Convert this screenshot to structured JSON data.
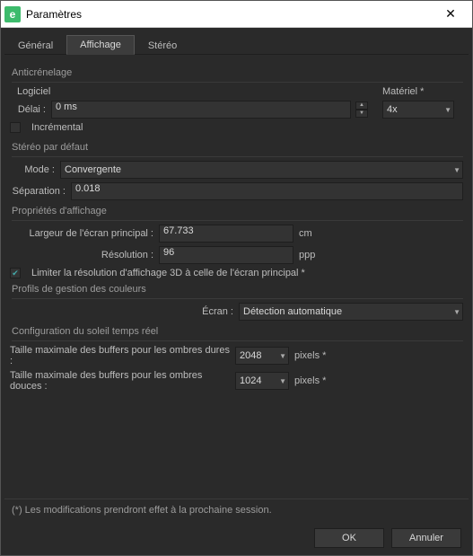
{
  "window": {
    "title": "Paramètres",
    "app_glyph": "e"
  },
  "tabs": {
    "general": "Général",
    "display": "Affichage",
    "stereo": "Stéréo"
  },
  "antialias": {
    "title": "Anticrénelage",
    "software_label": "Logiciel",
    "delay_label": "Délai :",
    "delay_value": "0 ms",
    "incremental_label": "Incrémental",
    "hardware_label": "Matériel *",
    "hardware_value": "4x"
  },
  "stereo": {
    "title": "Stéréo par défaut",
    "mode_label": "Mode :",
    "mode_value": "Convergente",
    "separation_label": "Séparation :",
    "separation_value": "0.018"
  },
  "display_props": {
    "title": "Propriétés d'affichage",
    "width_label": "Largeur de l'écran principal :",
    "width_value": "67.733",
    "width_unit": "cm",
    "res_label": "Résolution :",
    "res_value": "96",
    "res_unit": "ppp",
    "limit_label": "Limiter la résolution d'affichage 3D à celle de l'écran principal *",
    "limit_checked": true
  },
  "color": {
    "title": "Profils de gestion des couleurs",
    "screen_label": "Écran :",
    "screen_value": "Détection automatique"
  },
  "sun": {
    "title": "Configuration du soleil temps réel",
    "hard_label": "Taille maximale des buffers pour les ombres dures :",
    "hard_value": "2048",
    "soft_label": "Taille maximale des buffers pour les ombres douces :",
    "soft_value": "1024",
    "unit": "pixels *"
  },
  "footer": {
    "note": "(*) Les modifications prendront effet à la prochaine session.",
    "ok": "OK",
    "cancel": "Annuler"
  }
}
